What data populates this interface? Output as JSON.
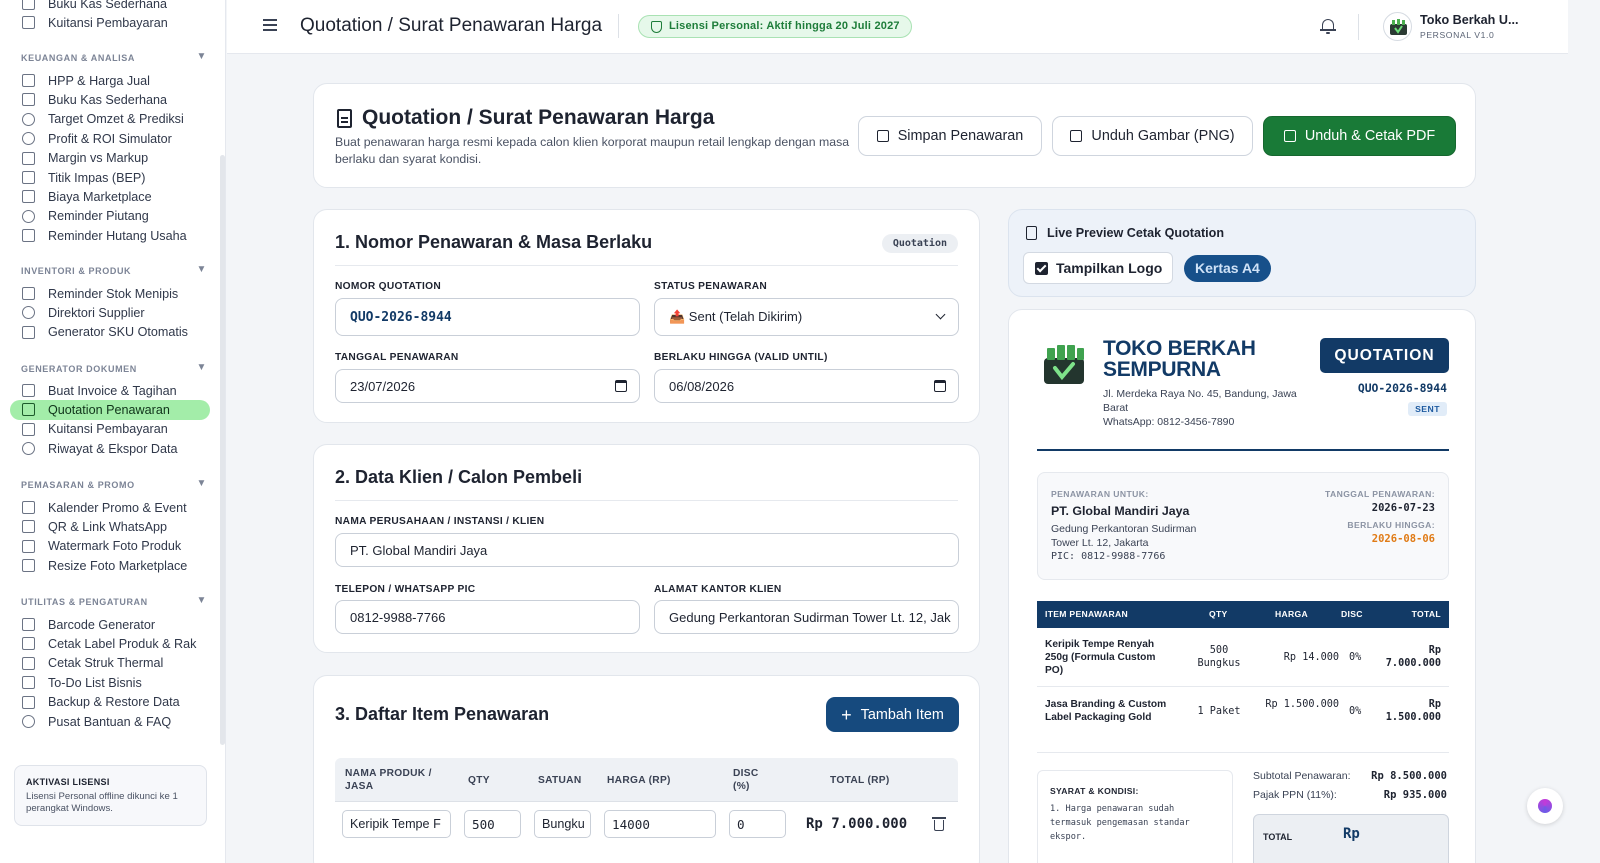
{
  "sidebar": {
    "top_items": [
      "Buku Kas Sederhana",
      "Kuitansi Pembayaran"
    ],
    "sections": [
      {
        "title": "KEUANGAN & ANALISA",
        "items": [
          "HPP & Harga Jual",
          "Buku Kas Sederhana",
          "Target Omzet & Prediksi",
          "Profit & ROI Simulator",
          "Margin vs Markup",
          "Titik Impas (BEP)",
          "Biaya Marketplace",
          "Reminder Piutang",
          "Reminder Hutang Usaha"
        ]
      },
      {
        "title": "INVENTORI & PRODUK",
        "items": [
          "Reminder Stok Menipis",
          "Direktori Supplier",
          "Generator SKU Otomatis"
        ]
      },
      {
        "title": "GENERATOR DOKUMEN",
        "items": [
          "Buat Invoice & Tagihan",
          "Quotation Penawaran",
          "Kuitansi Pembayaran",
          "Riwayat & Ekspor Data"
        ]
      },
      {
        "title": "PEMASARAN & PROMO",
        "items": [
          "Kalender Promo & Event",
          "QR & Link WhatsApp",
          "Watermark Foto Produk",
          "Resize Foto Marketplace"
        ]
      },
      {
        "title": "UTILITAS & PENGATURAN",
        "items": [
          "Barcode Generator",
          "Cetak Label Produk & Rak",
          "Cetak Struk Thermal",
          "To-Do List Bisnis",
          "Backup & Restore Data",
          "Pusat Bantuan & FAQ"
        ]
      }
    ],
    "active_item": "Quotation Penawaran",
    "license": {
      "title": "AKTIVASI LISENSI",
      "desc": "Lisensi Personal offline dikunci ke 1 perangkat Windows."
    }
  },
  "topbar": {
    "title": "Quotation / Surat Penawaran Harga",
    "license_badge": "Lisensi Personal: Aktif hingga 20 Juli 2027",
    "user_name": "Toko Berkah U...",
    "user_sub": "PERSONAL V1.0"
  },
  "header": {
    "title": "Quotation / Surat Penawaran Harga",
    "desc": "Buat penawaran harga resmi kepada calon klien korporat maupun retail lengkap dengan masa berlaku dan syarat kondisi.",
    "btn_save": "Simpan Penawaran",
    "btn_png": "Unduh Gambar (PNG)",
    "btn_pdf": "Unduh & Cetak PDF"
  },
  "section1": {
    "title": "1. Nomor Penawaran & Masa Berlaku",
    "tag": "Quotation",
    "lbl_no": "NOMOR QUOTATION",
    "val_no": "QUO-2026-8944",
    "lbl_status": "STATUS PENAWARAN",
    "val_status": "📤 Sent (Telah Dikirim)",
    "lbl_date": "TANGGAL PENAWARAN",
    "val_date": "23/07/2026",
    "lbl_valid": "BERLAKU HINGGA (VALID UNTIL)",
    "val_valid": "06/08/2026"
  },
  "section2": {
    "title": "2. Data Klien / Calon Pembeli",
    "lbl_company": "NAMA PERUSAHAAN / INSTANSI / KLIEN",
    "val_company": "PT. Global Mandiri Jaya",
    "lbl_phone": "TELEPON / WHATSAPP PIC",
    "val_phone": "0812-9988-7766",
    "lbl_addr": "ALAMAT KANTOR KLIEN",
    "val_addr": "Gedung Perkantoran Sudirman Tower Lt. 12, Jak"
  },
  "section3": {
    "title": "3. Daftar Item Penawaran",
    "add_btn": "Tambah Item",
    "cols": [
      "NAMA PRODUK / JASA",
      "QTY",
      "SATUAN",
      "HARGA (RP)",
      "DISC (%)",
      "TOTAL (RP)"
    ],
    "row1": {
      "name": "Keripik Tempe F",
      "qty": "500",
      "unit": "Bungku",
      "price": "14000",
      "disc": "0",
      "total": "Rp 7.000.000"
    }
  },
  "preview": {
    "title": "Live Preview Cetak Quotation",
    "show_logo": "Tampilkan Logo",
    "paper": "Kertas A4",
    "store_name": "TOKO BERKAH SEMPURNA",
    "store_addr": "Jl. Merdeka Raya No. 45, Bandung, Jawa Barat",
    "store_wa": "WhatsApp: 0812-3456-7890",
    "doc_badge": "QUOTATION",
    "doc_no": "QUO-2026-8944",
    "doc_status": "SENT",
    "to_label": "PENAWARAN UNTUK:",
    "to_name": "PT. Global Mandiri Jaya",
    "to_addr": "Gedung Perkantoran Sudirman Tower Lt. 12, Jakarta",
    "to_pic": "PIC: 0812-9988-7766",
    "date_label": "TANGGAL PENAWARAN:",
    "date_val": "2026-07-23",
    "valid_label": "BERLAKU HINGGA:",
    "valid_val": "2026-08-06",
    "cols": [
      "ITEM PENAWARAN",
      "QTY",
      "HARGA",
      "DISC",
      "TOTAL"
    ],
    "rows": [
      {
        "item": "Keripik Tempe Renyah 250g (Formula Custom PO)",
        "qty": "500 Bungkus",
        "price": "Rp 14.000",
        "disc": "0%",
        "total": "Rp 7.000.000"
      },
      {
        "item": "Jasa Branding & Custom Label Packaging Gold",
        "qty": "1 Paket",
        "price": "Rp 1.500.000",
        "disc": "0%",
        "total": "Rp 1.500.000"
      }
    ],
    "terms_title": "SYARAT & KONDISI:",
    "terms_1": "1. Harga penawaran sudah termasuk pengemasan standar ekspor.",
    "subtotal_label": "Subtotal Penawaran:",
    "subtotal_val": "Rp 8.500.000",
    "tax_label": "Pajak PPN (11%):",
    "tax_val": "Rp 935.000",
    "total_label": "TOTAL",
    "total_val": "Rp"
  }
}
